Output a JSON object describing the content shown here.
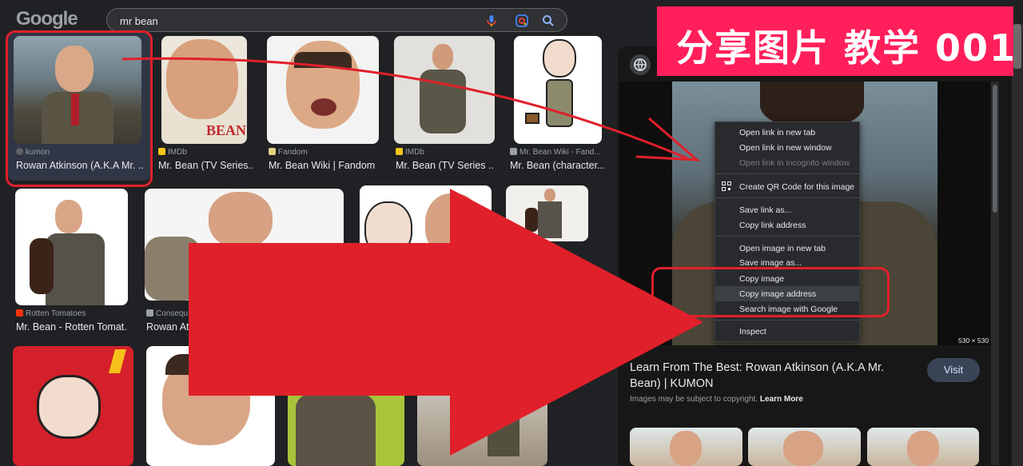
{
  "header": {
    "logo": "Google",
    "search_value": "mr bean"
  },
  "grid": {
    "row1": [
      {
        "source": "kumon",
        "title": "Rowan Atkinson (A.K.A Mr. ..."
      },
      {
        "source": "IMDb",
        "title": "Mr. Bean (TV Series..."
      },
      {
        "source": "Fandom",
        "title": "Mr. Bean Wiki | Fandom"
      },
      {
        "source": "IMDb",
        "title": "Mr. Bean (TV Series ..."
      },
      {
        "source": "Mr. Bean Wiki - Fand...",
        "title": "Mr. Bean (character..."
      }
    ],
    "row2": [
      {
        "source": "Rotten Tomatoes",
        "title": "Mr. Bean - Rotten Tomat..."
      },
      {
        "source": "Consequ",
        "title": "Rowan Atk"
      }
    ],
    "thumb1_caption": "BEAN"
  },
  "panel": {
    "dims": "530 × 530",
    "title": "Learn From The Best: Rowan Atkinson (A.K.A Mr. Bean) | KUMON",
    "visit_label": "Visit",
    "copyright": "Images may be subject to copyright.",
    "learn_more": "Learn More"
  },
  "context_menu": {
    "items": [
      {
        "label": "Open link in new tab"
      },
      {
        "label": "Open link in new window"
      },
      {
        "label": "Open link in incognito window"
      },
      {
        "label": "Create QR Code for this image"
      },
      {
        "label": "Save link as..."
      },
      {
        "label": "Copy link address"
      },
      {
        "label": "Open image in new tab"
      },
      {
        "label": "Save image as..."
      },
      {
        "label": "Copy image"
      },
      {
        "label": "Copy image address"
      },
      {
        "label": "Search image with Google"
      },
      {
        "label": "Inspect"
      }
    ]
  },
  "overlay": {
    "banner_text": "分享图片 教学 001"
  },
  "colors": {
    "banner": "#ff1f5a",
    "annotation_red": "#e0202a",
    "background": "#202124"
  }
}
